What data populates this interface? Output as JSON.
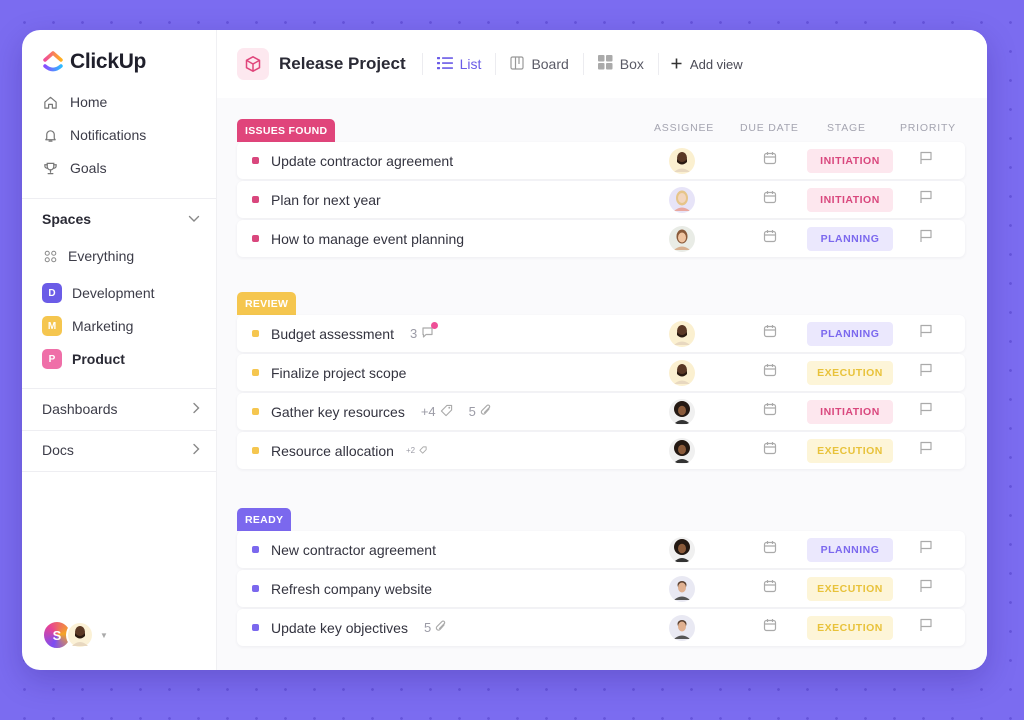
{
  "app": {
    "name": "ClickUp"
  },
  "colors": {
    "background": "#7b6cf0",
    "accent": "#6b5ce7",
    "issues": "#e0457b",
    "review": "#f5c64f",
    "ready": "#7b68ee",
    "stage_initiation_bg": "#fde7ee",
    "stage_initiation_fg": "#d9477d",
    "stage_planning_bg": "#ebe8fd",
    "stage_planning_fg": "#7b68ee",
    "stage_execution_bg": "#fdf5d8",
    "stage_execution_fg": "#e8c23a"
  },
  "sidebar": {
    "nav": [
      {
        "label": "Home",
        "icon": "home-icon"
      },
      {
        "label": "Notifications",
        "icon": "bell-icon"
      },
      {
        "label": "Goals",
        "icon": "trophy-icon"
      }
    ],
    "spaces_label": "Spaces",
    "everything_label": "Everything",
    "spaces": [
      {
        "letter": "D",
        "label": "Development",
        "color": "#6b5ce7"
      },
      {
        "letter": "M",
        "label": "Marketing",
        "color": "#f5c64f"
      },
      {
        "letter": "P",
        "label": "Product",
        "color": "#ef6fa8"
      }
    ],
    "dashboards_label": "Dashboards",
    "docs_label": "Docs",
    "user_initial": "S"
  },
  "header": {
    "project_title": "Release Project",
    "views": [
      {
        "label": "List",
        "icon": "list-icon",
        "active": true
      },
      {
        "label": "Board",
        "icon": "board-icon",
        "active": false
      },
      {
        "label": "Box",
        "icon": "box-icon",
        "active": false
      }
    ],
    "add_view_label": "Add view"
  },
  "columns": {
    "assignee": "ASSIGNEE",
    "due_date": "DUE DATE",
    "stage": "STAGE",
    "priority": "PRIORITY"
  },
  "groups": [
    {
      "label": "ISSUES FOUND",
      "tasks": [
        {
          "name": "Update contractor agreement",
          "stage": "INITIATION"
        },
        {
          "name": "Plan for next year",
          "stage": "INITIATION"
        },
        {
          "name": "How to manage event planning",
          "stage": "PLANNING"
        }
      ]
    },
    {
      "label": "REVIEW",
      "tasks": [
        {
          "name": "Budget assessment",
          "comments": "3",
          "stage": "PLANNING"
        },
        {
          "name": "Finalize project scope",
          "stage": "EXECUTION"
        },
        {
          "name": "Gather key resources",
          "tags": "+4",
          "attachments": "5",
          "stage": "INITIATION"
        },
        {
          "name": "Resource allocation",
          "tags": "+2",
          "stage": "EXECUTION"
        }
      ]
    },
    {
      "label": "READY",
      "tasks": [
        {
          "name": "New contractor agreement",
          "stage": "PLANNING"
        },
        {
          "name": "Refresh company website",
          "stage": "EXECUTION"
        },
        {
          "name": "Update key objectives",
          "attachments": "5",
          "stage": "EXECUTION"
        }
      ]
    }
  ]
}
